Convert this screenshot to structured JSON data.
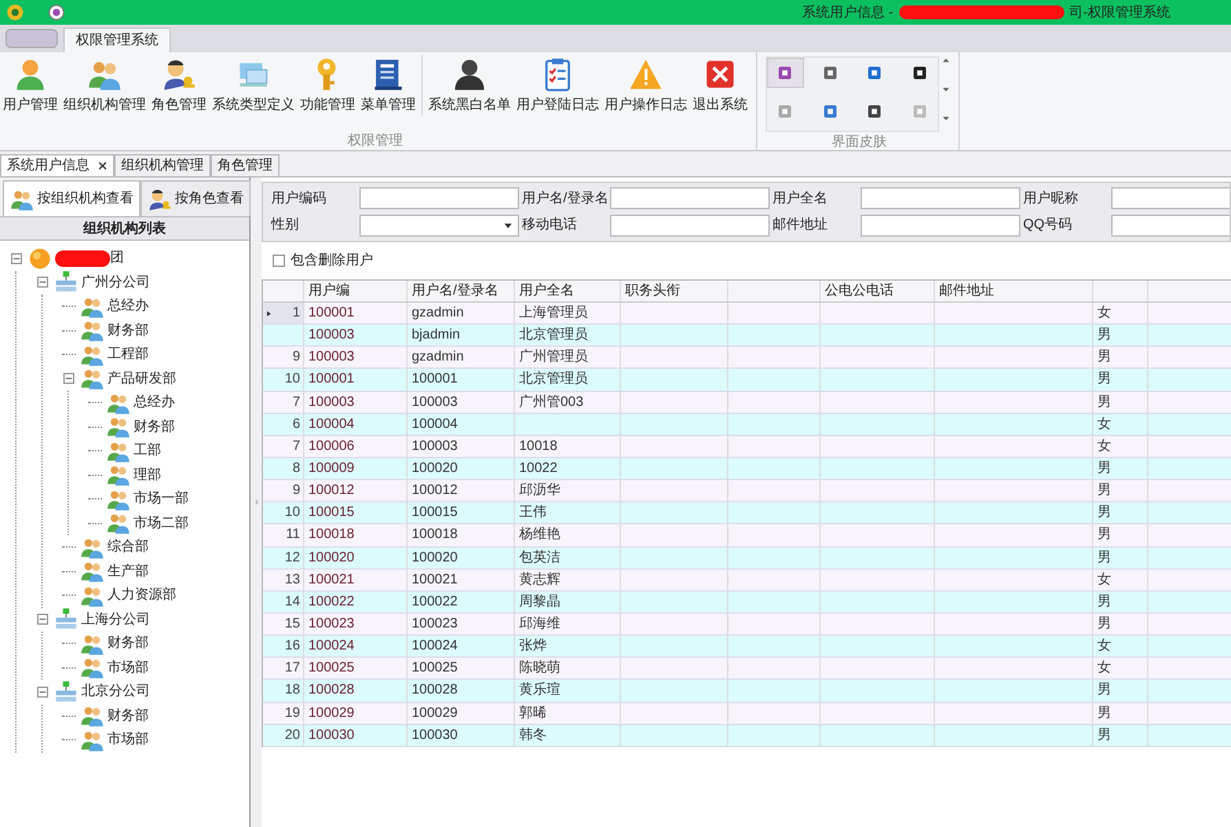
{
  "title_bar": {
    "title_start": "系统用户信息 - ",
    "title_end": "司-权限管理系统"
  },
  "ribbon": {
    "tabs": [
      {
        "label": "权限管理系统",
        "selected": true
      }
    ],
    "groups": [
      {
        "label": "权限管理",
        "buttons": [
          {
            "label": "用户管理",
            "kind": "user"
          },
          {
            "label": "组织机构管理",
            "kind": "org"
          },
          {
            "label": "角色管理",
            "kind": "role"
          },
          {
            "label": "系统类型定义",
            "kind": "systype"
          },
          {
            "label": "功能管理",
            "kind": "key"
          },
          {
            "label": "菜单管理",
            "kind": "menu"
          },
          {
            "label": "系统黑白名单",
            "kind": "blacklist",
            "separator": true
          },
          {
            "label": "用户登陆日志",
            "kind": "loginlog"
          },
          {
            "label": "用户操作日志",
            "kind": "oplog"
          },
          {
            "label": "退出系统",
            "kind": "exit"
          }
        ]
      }
    ],
    "skins": {
      "label": "界面皮肤"
    }
  },
  "doc_tabs": [
    {
      "label": "系统用户信息",
      "selected": true,
      "closable": true
    },
    {
      "label": "组织机构管理",
      "selected": false,
      "closable": false
    },
    {
      "label": "角色管理",
      "selected": false,
      "closable": false
    }
  ],
  "left_panel": {
    "tabs": [
      {
        "label": "按组织机构查看",
        "kind": "org",
        "selected": true
      },
      {
        "label": "按角色查看",
        "kind": "role",
        "selected": false
      }
    ],
    "tree_title": "组织机构列表",
    "tree": [
      {
        "label": "团",
        "kind": "root",
        "expanded": true,
        "children": [
          {
            "label": "广州分公司",
            "kind": "branch",
            "expanded": true,
            "children": [
              {
                "label": "总经办",
                "kind": "dept"
              },
              {
                "label": "财务部",
                "kind": "dept"
              },
              {
                "label": "工程部",
                "kind": "dept"
              },
              {
                "label": "产品研发部",
                "kind": "dept",
                "expanded": true,
                "children": [
                  {
                    "label": "总经办",
                    "kind": "dept"
                  },
                  {
                    "label": "财务部",
                    "kind": "dept"
                  },
                  {
                    "label": "工部",
                    "kind": "dept"
                  },
                  {
                    "label": "理部",
                    "kind": "dept"
                  },
                  {
                    "label": "市场一部",
                    "kind": "dept"
                  },
                  {
                    "label": "市场二部",
                    "kind": "dept"
                  }
                ]
              },
              {
                "label": "综合部",
                "kind": "dept"
              },
              {
                "label": "生产部",
                "kind": "dept"
              },
              {
                "label": "人力资源部",
                "kind": "dept"
              }
            ]
          },
          {
            "label": "上海分公司",
            "kind": "branch",
            "expanded": true,
            "children": [
              {
                "label": "财务部",
                "kind": "dept"
              },
              {
                "label": "市场部",
                "kind": "dept"
              }
            ]
          },
          {
            "label": "北京分公司",
            "kind": "branch",
            "expanded": true,
            "children": [
              {
                "label": "财务部",
                "kind": "dept"
              },
              {
                "label": "市场部",
                "kind": "dept"
              }
            ]
          }
        ]
      }
    ]
  },
  "filters": [
    {
      "label": "用户编码",
      "kind": "text"
    },
    {
      "label": "用户名/登录名",
      "kind": "text"
    },
    {
      "label": "用户全名",
      "kind": "text"
    },
    {
      "label": "用户昵称",
      "kind": "text"
    },
    {
      "label": "性别",
      "kind": "select"
    },
    {
      "label": "移动电话",
      "kind": "text"
    },
    {
      "label": "邮件地址",
      "kind": "text"
    },
    {
      "label": "QQ号码",
      "kind": "text"
    }
  ],
  "include_deleted": {
    "label": "包含删除用户",
    "checked": false
  },
  "table": {
    "columns": [
      {
        "label": "用户编"
      },
      {
        "label": "用户名/登录名"
      },
      {
        "label": "用户全名"
      },
      {
        "label": "职务头衔"
      },
      {},
      {
        "label": "公电公电话"
      },
      {
        "label": "邮件地址"
      },
      {}
    ],
    "rows": [
      {
        "number": "1",
        "current": true,
        "cells": [
          "100001",
          "gzadmin",
          "上海管理员",
          "",
          "",
          "",
          "",
          "女"
        ]
      },
      {
        "current": false,
        "cells": [
          "100003",
          "bjadmin",
          "北京管理员",
          "",
          "",
          "",
          "",
          "男"
        ]
      },
      {
        "number": "9",
        "current": false,
        "cells": [
          "100003",
          "gzadmin",
          "广州管理员",
          "",
          "",
          "",
          "",
          "男"
        ]
      },
      {
        "number": "10",
        "current": false,
        "cells": [
          "100001",
          "100001",
          "北京管理员",
          "",
          "",
          "",
          "",
          "男"
        ]
      },
      {
        "number": "7",
        "current": false,
        "cells": [
          "100003",
          "100003",
          "广州管003",
          "",
          "",
          "",
          "",
          "男"
        ]
      },
      {
        "number": "6",
        "current": false,
        "cells": [
          "100004",
          "100004",
          "",
          "",
          "",
          "",
          "",
          "女"
        ]
      },
      {
        "number": "7",
        "current": false,
        "cells": [
          "100006",
          "100003",
          "10018",
          "",
          "",
          "",
          "",
          "女"
        ]
      },
      {
        "number": "8",
        "current": false,
        "cells": [
          "100009",
          "100020",
          "10022",
          "",
          "",
          "",
          "",
          "男"
        ]
      },
      {
        "number": "9",
        "current": false,
        "cells": [
          "100012",
          "100012",
          "邱沥华",
          "",
          "",
          "",
          "",
          "男"
        ]
      },
      {
        "number": "10",
        "current": false,
        "cells": [
          "100015",
          "100015",
          "王伟",
          "",
          "",
          "",
          "",
          "男"
        ]
      },
      {
        "number": "11",
        "current": false,
        "cells": [
          "100018",
          "100018",
          "杨维艳",
          "",
          "",
          "",
          "",
          "男"
        ]
      },
      {
        "number": "12",
        "current": false,
        "cells": [
          "100020",
          "100020",
          "包英洁",
          "",
          "",
          "",
          "",
          "男"
        ]
      },
      {
        "number": "13",
        "current": false,
        "cells": [
          "100021",
          "100021",
          "黄志辉",
          "",
          "",
          "",
          "",
          "女"
        ]
      },
      {
        "number": "14",
        "current": false,
        "cells": [
          "100022",
          "100022",
          "周黎晶",
          "",
          "",
          "",
          "",
          "男"
        ]
      },
      {
        "number": "15",
        "current": false,
        "cells": [
          "100023",
          "100023",
          "邱海维",
          "",
          "",
          "",
          "",
          "男"
        ]
      },
      {
        "number": "16",
        "current": false,
        "cells": [
          "100024",
          "100024",
          "张烨",
          "",
          "",
          "",
          "",
          "女"
        ]
      },
      {
        "number": "17",
        "current": false,
        "cells": [
          "100025",
          "100025",
          "陈晓萌",
          "",
          "",
          "",
          "",
          "女"
        ]
      },
      {
        "number": "18",
        "current": false,
        "cells": [
          "100028",
          "100028",
          "黄乐瑄",
          "",
          "",
          "",
          "",
          "男"
        ]
      },
      {
        "number": "19",
        "current": false,
        "cells": [
          "100029",
          "100029",
          "郭晞",
          "",
          "",
          "",
          "",
          "男"
        ]
      },
      {
        "number": "20",
        "current": false,
        "cells": [
          "100030",
          "100030",
          "韩冬",
          "",
          "",
          "",
          "",
          "男"
        ]
      }
    ]
  }
}
